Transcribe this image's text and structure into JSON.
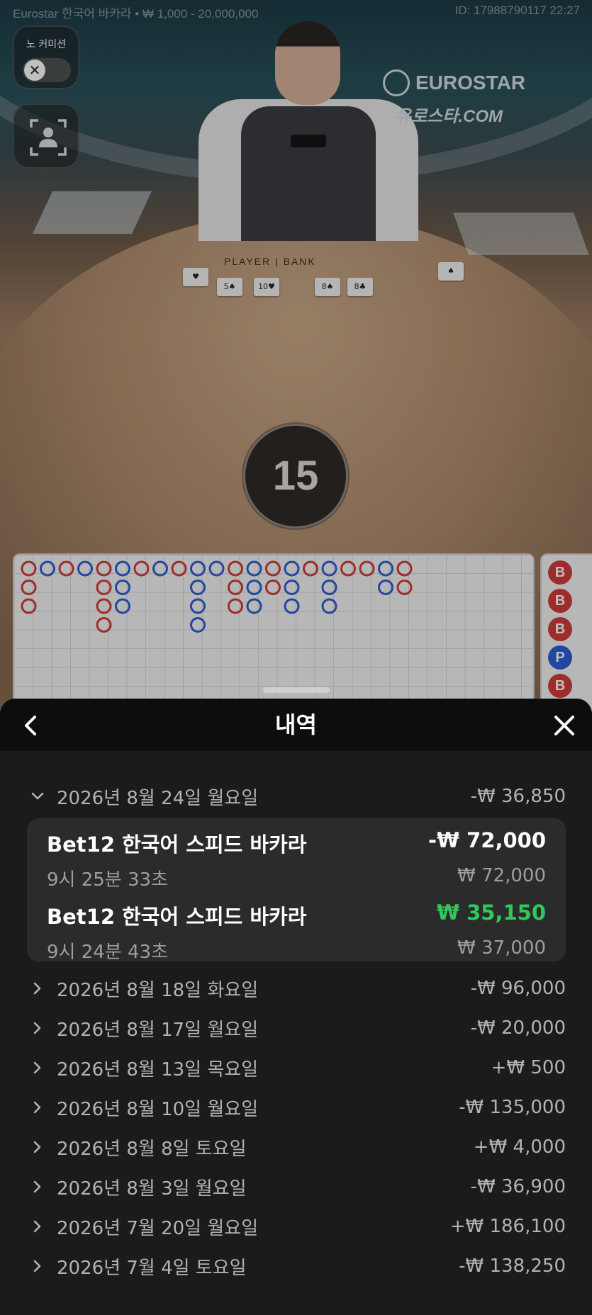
{
  "stream": {
    "table_info": "Eurostar 한국어 바카라 • ₩ 1,000 - 20,000,000",
    "round_id": "ID: 17988790117 22:27",
    "brand_line1": "EUROSTAR",
    "brand_line2": "유로스타.COM",
    "felt_label": "PLAYER | BANK",
    "countdown": "15"
  },
  "controls": {
    "no_commission_label": "노 커미션",
    "no_commission_enabled": false
  },
  "side_road": [
    "B",
    "B",
    "B",
    "P",
    "B"
  ],
  "history": {
    "title": "내역",
    "expanded_day": {
      "date": "2026년 8월 24일 월요일",
      "total": "-₩ 36,850",
      "bets": [
        {
          "game": "Bet12 한국어 스피드 바카라",
          "time": "9시 25분 33초",
          "result": "-₩ 72,000",
          "stake": "₩ 72,000",
          "win": false
        },
        {
          "game": "Bet12 한국어 스피드 바카라",
          "time": "9시 24분 43초",
          "result": "₩ 35,150",
          "stake": "₩ 37,000",
          "win": true
        }
      ]
    },
    "days": [
      {
        "date": "2026년 8월 18일 화요일",
        "total": "-₩ 96,000"
      },
      {
        "date": "2026년 8월 17일 월요일",
        "total": "-₩ 20,000"
      },
      {
        "date": "2026년 8월 13일 목요일",
        "total": "+₩ 500"
      },
      {
        "date": "2026년 8월 10일 월요일",
        "total": "-₩ 135,000"
      },
      {
        "date": "2026년 8월 8일 토요일",
        "total": "+₩ 4,000"
      },
      {
        "date": "2026년 8월 3일 월요일",
        "total": "-₩ 36,900"
      },
      {
        "date": "2026년 7월 20일 월요일",
        "total": "+₩ 186,100"
      },
      {
        "date": "2026년 7월 4일 토요일",
        "total": "-₩ 138,250"
      }
    ]
  },
  "colors": {
    "win": "#2fc85a",
    "banker": "#d23b3b",
    "player": "#2d5fd6"
  }
}
